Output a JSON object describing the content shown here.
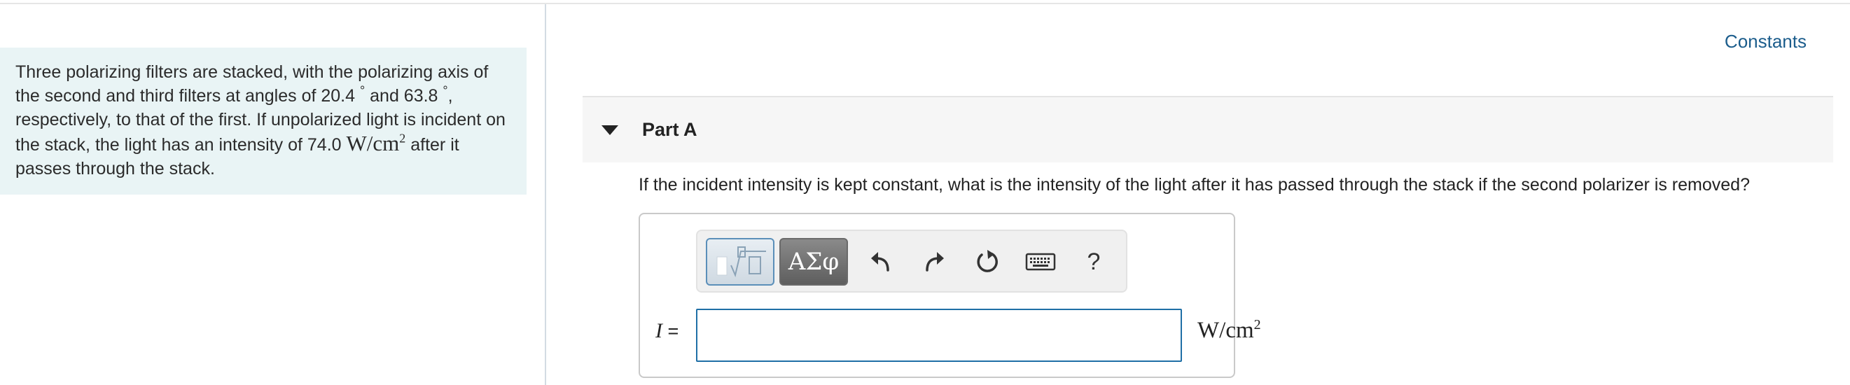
{
  "problem": {
    "text_1": "Three polarizing filters are stacked, with the polarizing axis of the second and third filters at angles of 20.4",
    "degree_symbol": "°",
    "text_2": " and 63.8",
    "text_3": ", respectively, to that of the first. If unpolarized light is incident on the stack, the light has an intensity of 74.0",
    "intensity_unit_base": "W/cm",
    "intensity_unit_exp": "2",
    "text_4": " after it passes through the stack."
  },
  "header": {
    "constants_link": "Constants"
  },
  "part": {
    "title": "Part A",
    "question": "If the incident intensity is kept constant, what is the intensity of the light after it has passed through the stack if the second polarizer is removed?"
  },
  "toolbar": {
    "greek_label": "ΑΣφ",
    "help_label": "?"
  },
  "answer": {
    "variable": "I",
    "equals": " =",
    "value": "",
    "unit_base": "W/cm",
    "unit_exp": "2"
  },
  "colors": {
    "problem_background": "#e9f4f5",
    "link": "#1c5d8c",
    "input_border": "#1f6fa6"
  }
}
